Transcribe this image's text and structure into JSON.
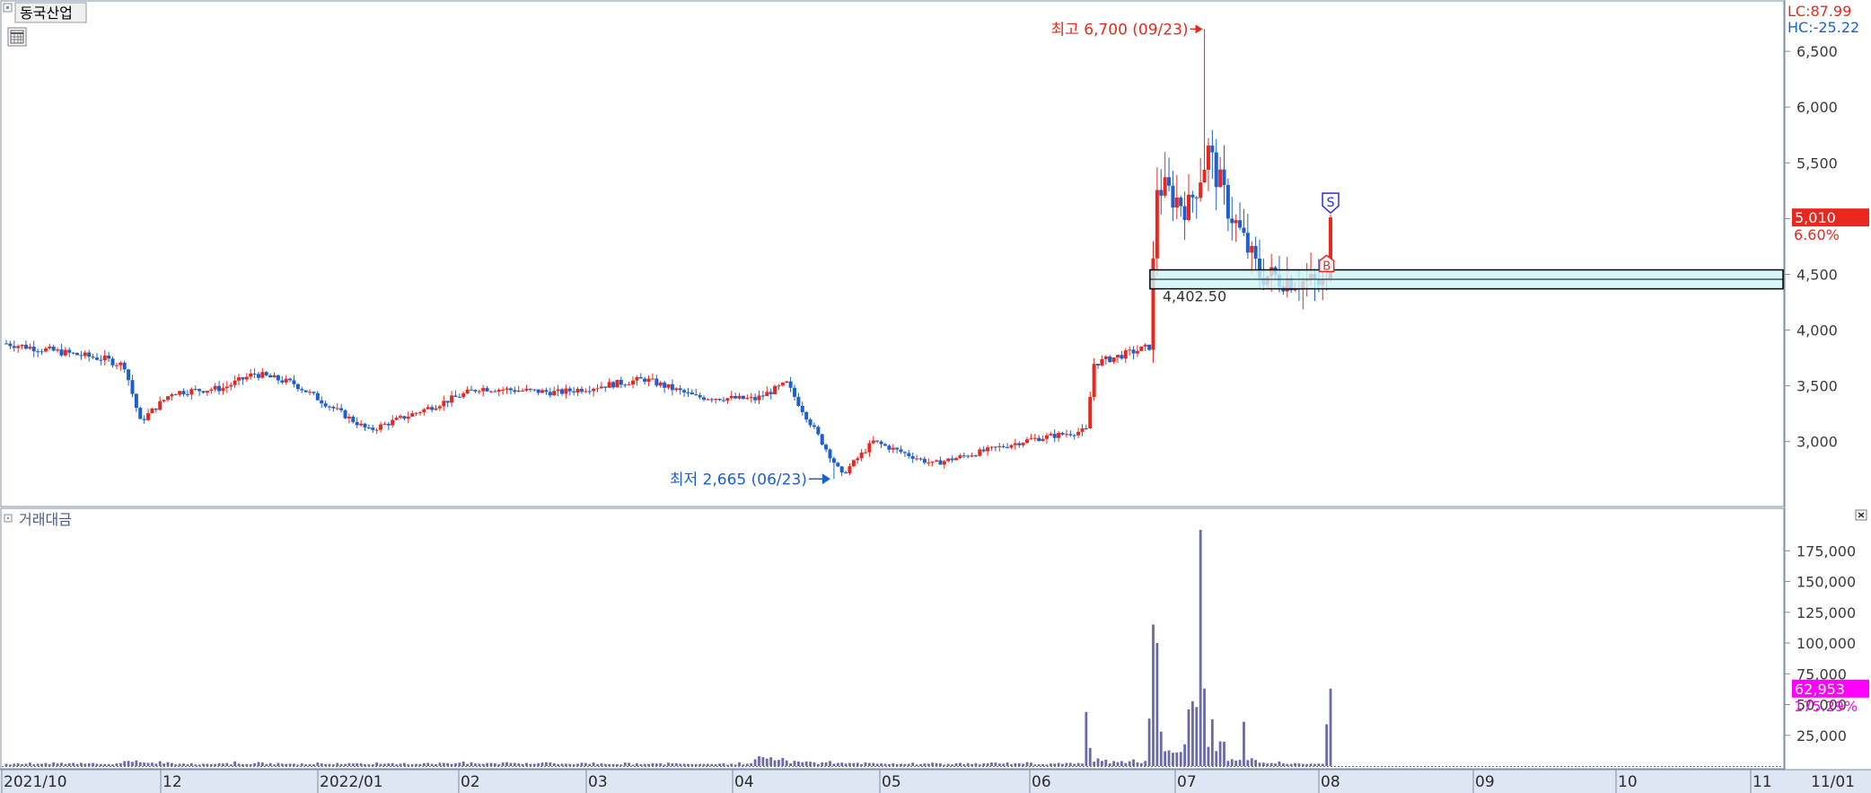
{
  "window": {
    "stock_name": "동국산업",
    "volume_panel_title": "거래대금",
    "calendar_icon": "calendar-icon",
    "close_icon": "close-icon"
  },
  "indicators": {
    "lc": "LC:87.99",
    "hc": "HC:-25.22"
  },
  "colors": {
    "up": "#e8281e",
    "down": "#1c5fd0",
    "volume": "#6a6aa8",
    "volume_tag": "#ff00ff",
    "box_fill": "#cdf4f6",
    "frame": "#7f8fa0",
    "grid": "#c8c8c8",
    "xaxis_bg": "#dde6f2"
  },
  "chart_data": [
    {
      "type": "candlestick",
      "period": "daily",
      "x_range": [
        "2021-10",
        "2022-11"
      ],
      "x_tick_labels": [
        "2021/10",
        "12",
        "2022/01",
        "02",
        "03",
        "04",
        "05",
        "06",
        "07",
        "08",
        "09",
        "10",
        "11",
        "11/01"
      ],
      "y_ticks": [
        "6,500",
        "6,000",
        "5,500",
        "5,000",
        "4,500",
        "4,000",
        "3,500",
        "3,000"
      ],
      "ylim": [
        2450,
        6920
      ],
      "grid": false,
      "last_price": "5,010",
      "last_change": "6.60%",
      "annotations": {
        "high": {
          "label": "최고 6,700 (09/23)",
          "value": 6700
        },
        "low": {
          "label": "최저 2,665 (06/23)",
          "value": 2665
        },
        "box": {
          "label": "4,402.50",
          "low": 4370,
          "high": 4540
        },
        "signals": [
          {
            "label": "S",
            "type": "sell"
          },
          {
            "label": "B",
            "type": "buy"
          }
        ]
      },
      "segments": [
        {
          "from": 0,
          "to": 25,
          "start": 3880,
          "end": 3740,
          "vol": 1
        },
        {
          "from": 25,
          "to": 30,
          "start": 3740,
          "end": 3680,
          "vol": 1
        },
        {
          "from": 30,
          "to": 34,
          "start": 3680,
          "end": 3180,
          "vol": 1.6
        },
        {
          "from": 34,
          "to": 42,
          "start": 3180,
          "end": 3440,
          "vol": 1.5
        },
        {
          "from": 42,
          "to": 55,
          "start": 3440,
          "end": 3480,
          "vol": 1
        },
        {
          "from": 55,
          "to": 63,
          "start": 3480,
          "end": 3610,
          "vol": 1.2
        },
        {
          "from": 63,
          "to": 73,
          "start": 3610,
          "end": 3520,
          "vol": 1
        },
        {
          "from": 73,
          "to": 92,
          "start": 3520,
          "end": 3100,
          "vol": 1
        },
        {
          "from": 92,
          "to": 107,
          "start": 3100,
          "end": 3300,
          "vol": 1
        },
        {
          "from": 107,
          "to": 120,
          "start": 3300,
          "end": 3480,
          "vol": 1.2
        },
        {
          "from": 120,
          "to": 140,
          "start": 3480,
          "end": 3440,
          "vol": 1.2
        },
        {
          "from": 140,
          "to": 162,
          "start": 3440,
          "end": 3560,
          "vol": 1
        },
        {
          "from": 162,
          "to": 175,
          "start": 3560,
          "end": 3400,
          "vol": 1
        },
        {
          "from": 175,
          "to": 190,
          "start": 3400,
          "end": 3380,
          "vol": 1
        },
        {
          "from": 190,
          "to": 198,
          "start": 3380,
          "end": 3520,
          "vol": 3
        },
        {
          "from": 198,
          "to": 212,
          "start": 3520,
          "end": 2700,
          "vol": 1.5
        },
        {
          "from": 212,
          "to": 220,
          "start": 2700,
          "end": 3000,
          "vol": 1.2
        },
        {
          "from": 220,
          "to": 235,
          "start": 3000,
          "end": 2800,
          "vol": 1
        },
        {
          "from": 235,
          "to": 260,
          "start": 2800,
          "end": 3020,
          "vol": 1
        },
        {
          "from": 260,
          "to": 274,
          "start": 3020,
          "end": 3100,
          "vol": 1
        },
        {
          "from": 274,
          "to": 276,
          "start": 3100,
          "end": 3700,
          "vol": 9
        },
        {
          "from": 276,
          "to": 290,
          "start": 3700,
          "end": 3850,
          "vol": 2
        },
        {
          "from": 290,
          "to": 292,
          "start": 3850,
          "end": 5300,
          "vol": 15
        },
        {
          "from": 292,
          "to": 300,
          "start": 5300,
          "end": 5100,
          "vol": 6
        },
        {
          "from": 300,
          "to": 305,
          "start": 5100,
          "end": 5600,
          "vol": 20
        },
        {
          "from": 305,
          "to": 310,
          "start": 5600,
          "end": 5100,
          "vol": 8
        },
        {
          "from": 310,
          "to": 318,
          "start": 5100,
          "end": 4500,
          "vol": 3
        },
        {
          "from": 318,
          "to": 335,
          "start": 4500,
          "end": 4400,
          "vol": 1.2
        },
        {
          "from": 335,
          "to": 337,
          "start": 4400,
          "end": 5010,
          "vol": 10
        }
      ],
      "series": [
        {
          "name": "거래대금",
          "type": "bar",
          "y_ticks": [
            "175,000",
            "150,000",
            "125,000",
            "100,000",
            "75,000",
            "50,000",
            "25,000"
          ],
          "ylim": [
            0,
            192000
          ],
          "last_value": "62,953",
          "last_change": "175.29%"
        }
      ]
    }
  ]
}
